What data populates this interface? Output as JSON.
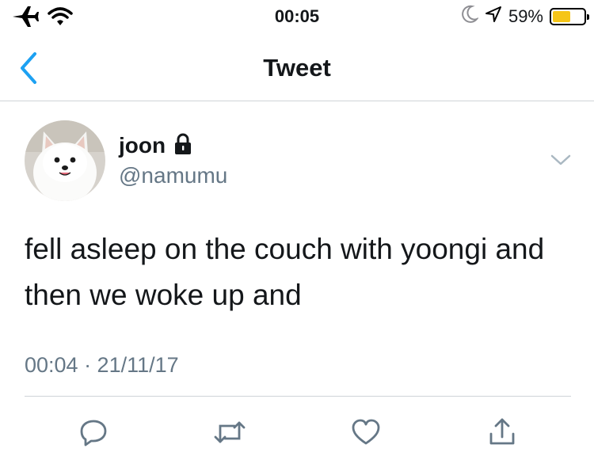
{
  "status_bar": {
    "time": "00:05",
    "battery_percent": "59%",
    "battery_level": 0.59,
    "icons": [
      "airplane-icon",
      "wifi-icon",
      "moon-icon",
      "location-arrow-icon",
      "battery-icon"
    ]
  },
  "nav": {
    "title": "Tweet",
    "back_icon": "chevron-left-icon"
  },
  "tweet": {
    "author_name": "joon",
    "author_handle": "@namumu",
    "protected_icon": "lock-icon",
    "text": "fell asleep on the couch with yoongi and then we woke up and",
    "timestamp": "00:04 · 21/11/17"
  },
  "actions": [
    "reply-icon",
    "retweet-icon",
    "like-icon",
    "share-icon"
  ],
  "colors": {
    "accent": "#1da1f2",
    "secondary_text": "#657786",
    "action_icon": "#657786",
    "battery_fill": "#f5c518"
  }
}
